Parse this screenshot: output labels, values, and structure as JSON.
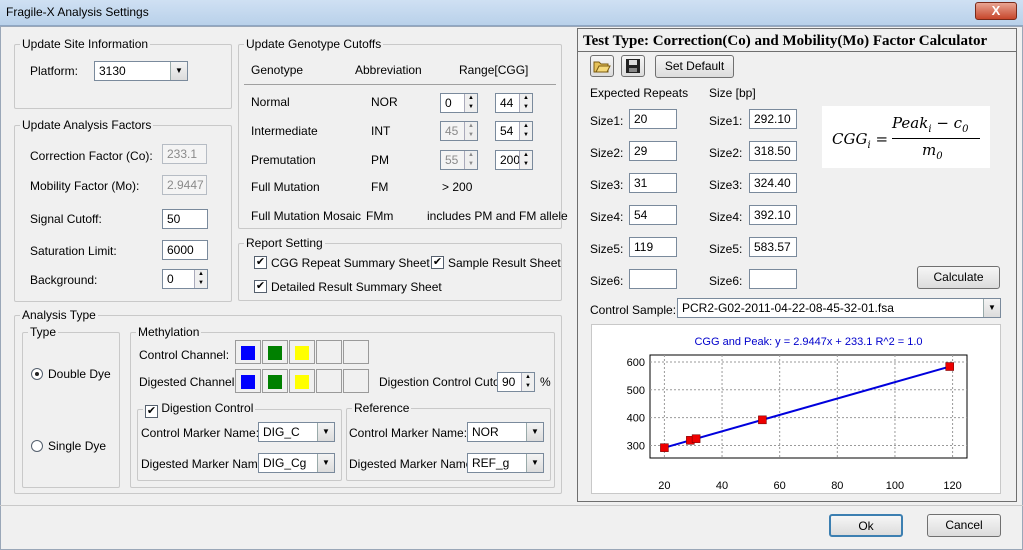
{
  "window": {
    "title": "Fragile-X Analysis Settings",
    "close_glyph": "X"
  },
  "site": {
    "legend": "Update Site Information",
    "platform_label": "Platform:",
    "platform_value": "3130"
  },
  "factors": {
    "legend": "Update Analysis Factors",
    "correction_label": "Correction Factor (Co):",
    "correction_value": "233.1",
    "mobility_label": "Mobility Factor (Mo):",
    "mobility_value": "2.9447",
    "signal_label": "Signal Cutoff:",
    "signal_value": "50",
    "saturation_label": "Saturation Limit:",
    "saturation_value": "6000",
    "background_label": "Background:",
    "background_value": "0"
  },
  "genotype": {
    "legend": "Update Genotype  Cutoffs",
    "col_genotype": "Genotype",
    "col_abbrev": "Abbreviation",
    "col_range": "Range[CGG]",
    "rows": [
      {
        "name": "Normal",
        "abbrev": "NOR",
        "low": "0",
        "high": "44"
      },
      {
        "name": "Intermediate",
        "abbrev": "INT",
        "low": "45",
        "high": "54"
      },
      {
        "name": "Premutation",
        "abbrev": "PM",
        "low": "55",
        "high": "200"
      }
    ],
    "full": {
      "name": "Full Mutation",
      "abbrev": "FM",
      "range": "> 200"
    },
    "mosaic": {
      "name": "Full Mutation Mosaic",
      "abbrev": "FMm",
      "range": "includes PM and FM allele"
    }
  },
  "report": {
    "legend": "Report Setting",
    "cgg_summary": "CGG Repeat Summary Sheet",
    "sample_result": "Sample Result Sheet",
    "detailed_summary": "Detailed Result Summary Sheet",
    "check_glyph": "✔"
  },
  "analysis": {
    "legend": "Analysis Type",
    "type_legend": "Type",
    "double_dye": "Double Dye",
    "single_dye": "Single Dye",
    "methylation_legend": "Methylation",
    "control_channel_label": "Control Channel:",
    "digested_channel_label": "Digested Channel:",
    "digestion_cutoff_label": "Digestion Control Cutoff:",
    "digestion_cutoff_value": "90",
    "percent": "%",
    "dig_control_legend": "Digestion Control",
    "dig_control_marker_label": "Control Marker Name:",
    "dig_control_marker_value": "DIG_C",
    "dig_digested_marker_label": "Digested Marker Name:",
    "dig_digested_marker_value": "DIG_Cg",
    "reference_legend": "Reference",
    "ref_control_marker_label": "Control Marker Name:",
    "ref_control_marker_value": "NOR",
    "ref_digested_marker_label": "Digested Marker Name:",
    "ref_digested_marker_value": "REF_g",
    "channel_colors": [
      "#0000ff",
      "#008000",
      "#ffff00",
      "",
      ""
    ]
  },
  "calculator": {
    "title": "Test Type: Correction(Co) and Mobility(Mo) Factor Calculator",
    "open_icon": "folder-open-icon",
    "save_icon": "floppy-disk-icon",
    "set_default": "Set Default",
    "expected_header": "Expected Repeats",
    "size_header": "Size [bp]",
    "rows": [
      {
        "label": "Size1:",
        "repeat": "20",
        "size": "292.10"
      },
      {
        "label": "Size2:",
        "repeat": "29",
        "size": "318.50"
      },
      {
        "label": "Size3:",
        "repeat": "31",
        "size": "324.40"
      },
      {
        "label": "Size4:",
        "repeat": "54",
        "size": "392.10"
      },
      {
        "label": "Size5:",
        "repeat": "119",
        "size": "583.57"
      },
      {
        "label": "Size6:",
        "repeat": "",
        "size": ""
      }
    ],
    "calculate": "Calculate",
    "control_sample_label": "Control Sample:",
    "control_sample_value": "PCR2-G02-2011-04-22-08-45-32-01.fsa",
    "formula": {
      "lhs": "CGG",
      "lhs_sub": "i",
      "eq": "=",
      "num": "Peak",
      "num_sub": "i",
      "num_minus": "− c",
      "num_sub2": "0",
      "den": "m",
      "den_sub": "0"
    }
  },
  "chart_data": {
    "type": "scatter",
    "title": "CGG and Peak: y = 2.9447x + 233.1   R^2 = 1.0",
    "xlabel": "",
    "ylabel": "",
    "xlim": [
      15,
      125
    ],
    "ylim": [
      255,
      625
    ],
    "x_ticks": [
      20,
      40,
      60,
      80,
      100,
      120
    ],
    "y_ticks": [
      300,
      400,
      500,
      600
    ],
    "grid": true,
    "points": {
      "x": [
        20,
        29,
        31,
        54,
        119
      ],
      "y": [
        292.1,
        318.5,
        324.4,
        392.1,
        583.57
      ]
    },
    "fit_line": {
      "slope": 2.9447,
      "intercept": 233.1,
      "x_range": [
        20,
        119
      ]
    },
    "colors": {
      "line": "#0000dd",
      "marker": "#ee0000",
      "title": "#0000cc"
    }
  },
  "footer": {
    "ok": "Ok",
    "cancel": "Cancel"
  }
}
